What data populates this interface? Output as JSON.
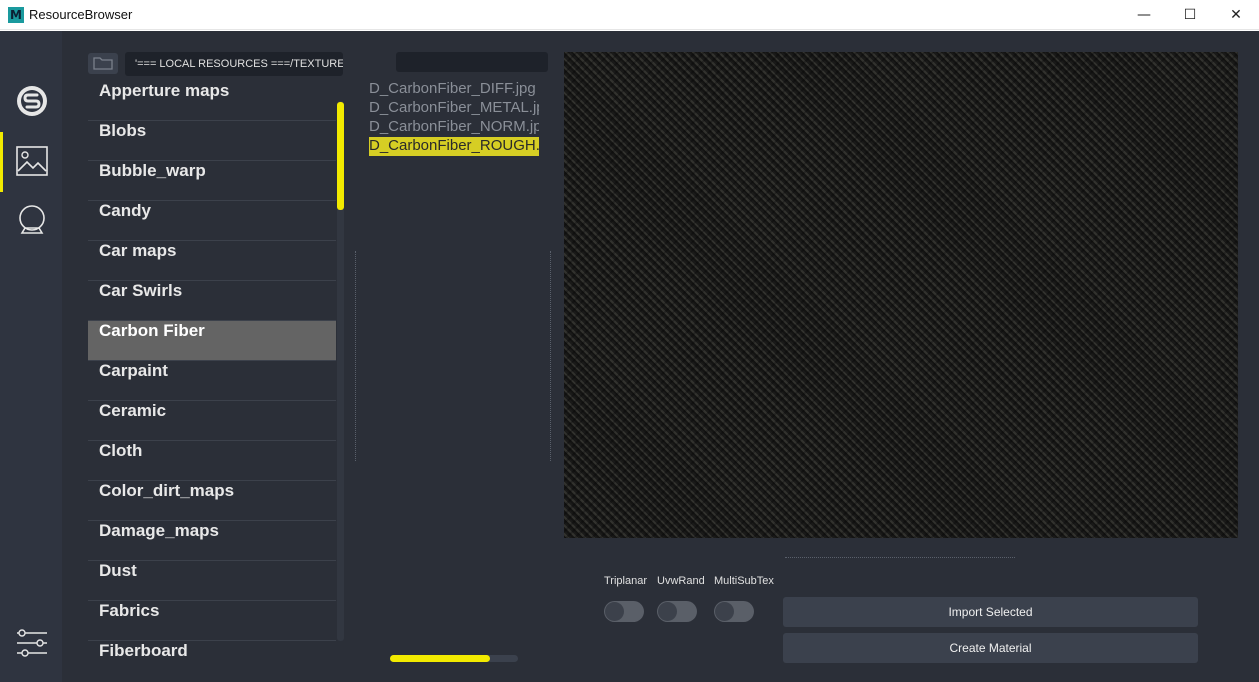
{
  "window": {
    "title": "ResourceBrowser",
    "app_icon_letter": "M",
    "minimize_glyph": "—",
    "maximize_glyph": "☐",
    "close_glyph": "✕"
  },
  "rail": {
    "items": [
      {
        "icon": "substance-logo-icon"
      },
      {
        "icon": "image-icon",
        "active": true
      },
      {
        "icon": "material-ball-icon"
      },
      {
        "icon": "sliders-icon"
      }
    ],
    "accent_color": "#f2ea00"
  },
  "path": {
    "text": "'=== LOCAL RESOURCES ===/TEXTURE"
  },
  "categories": [
    "Apperture maps",
    "Blobs",
    "Bubble_warp",
    "Candy",
    "Car maps",
    "Car Swirls",
    "Carbon Fiber",
    "Carpaint",
    "Ceramic",
    "Cloth",
    "Color_dirt_maps",
    "Damage_maps",
    "Dust",
    "Fabrics",
    "Fiberboard"
  ],
  "selected_category": "Carbon Fiber",
  "files": [
    "D_CarbonFiber_DIFF.jpg",
    "D_CarbonFiber_METAL.jpg",
    "D_CarbonFiber_NORM.jpg",
    "D_CarbonFiber_ROUGH.jpg"
  ],
  "selected_file": "D_CarbonFiber_ROUGH.jpg",
  "progress": 0.78,
  "toggles": [
    {
      "label": "Triplanar",
      "on": false
    },
    {
      "label": "UvwRand",
      "on": false
    },
    {
      "label": "MultiSubTex",
      "on": false
    }
  ],
  "buttons": {
    "import": "Import Selected",
    "create": "Create Material"
  }
}
